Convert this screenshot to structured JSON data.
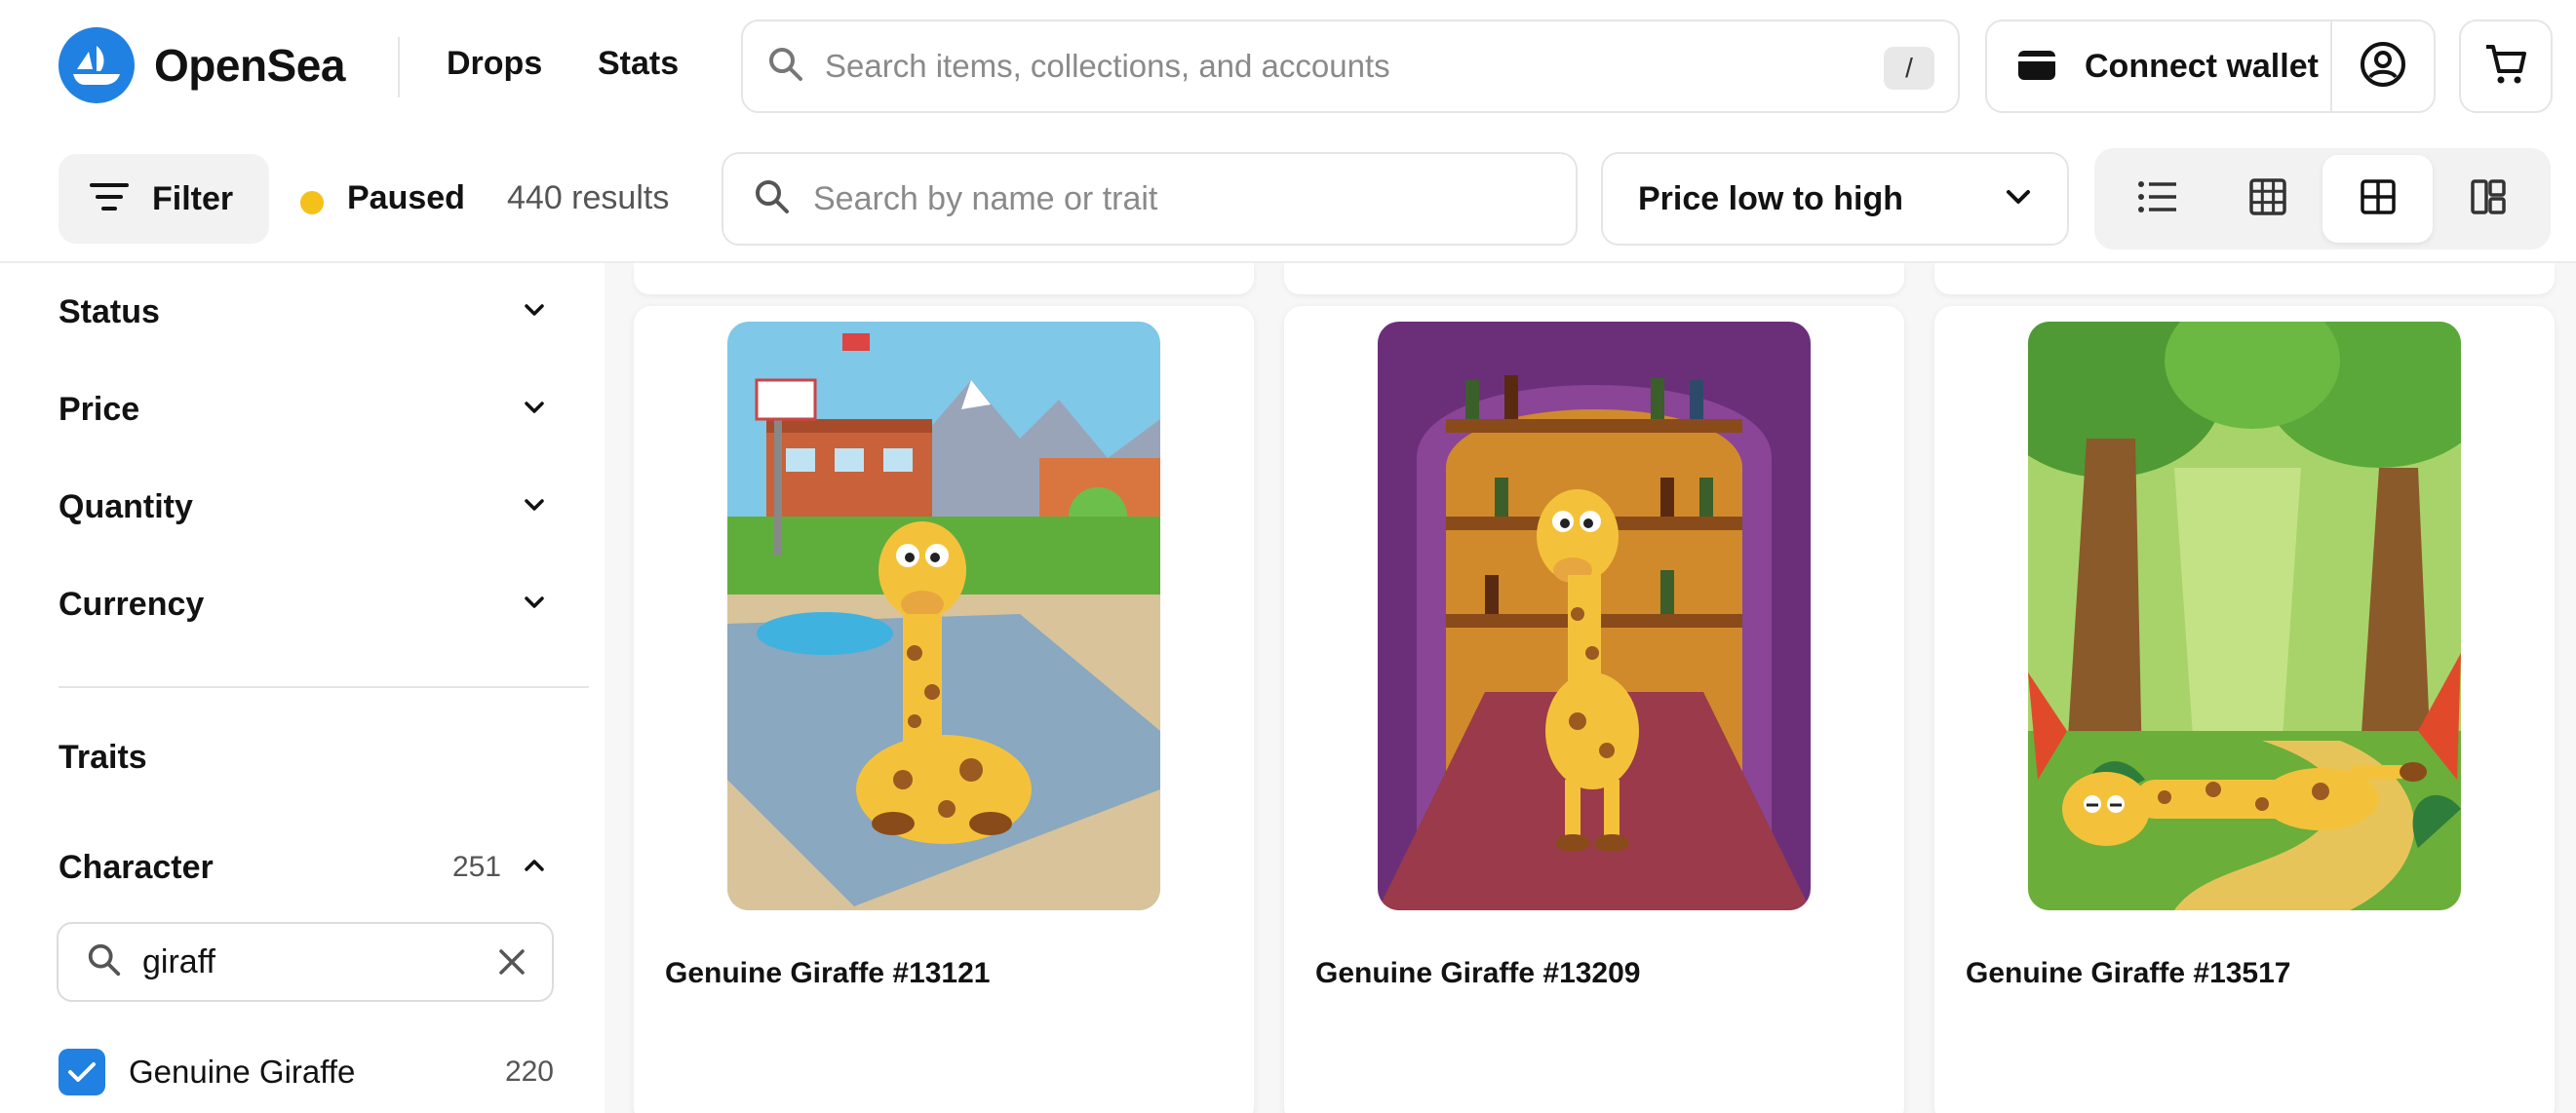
{
  "brand": {
    "name": "OpenSea",
    "accent": "#2081e2"
  },
  "nav": {
    "links": [
      "Drops",
      "Stats"
    ]
  },
  "search": {
    "placeholder": "Search items, collections, and accounts",
    "shortcut": "/"
  },
  "wallet": {
    "connect_label": "Connect wallet",
    "icon": "wallet-icon"
  },
  "toolbar": {
    "filter_label": "Filter",
    "status": "Paused",
    "status_color": "#f4c01a",
    "results": "440 results",
    "trait_search_placeholder": "Search by name or trait",
    "sort_selected": "Price low to high",
    "view_modes": [
      "list",
      "grid-dense",
      "grid",
      "grid-large"
    ],
    "active_view": "grid"
  },
  "sidebar": {
    "filters": [
      "Status",
      "Price",
      "Quantity",
      "Currency"
    ],
    "traits_heading": "Traits",
    "character": {
      "label": "Character",
      "count": "251",
      "search_value": "giraff",
      "options": [
        {
          "label": "Genuine Giraffe",
          "count": "220",
          "checked": true
        }
      ]
    }
  },
  "items": [
    {
      "title": "Genuine Giraffe #13121",
      "scene": "schoolyard basketball court",
      "pose": "sitting"
    },
    {
      "title": "Genuine Giraffe #13209",
      "scene": "wine cellar",
      "pose": "standing"
    },
    {
      "title": "Genuine Giraffe #13517",
      "scene": "jungle path",
      "pose": "lying"
    }
  ]
}
